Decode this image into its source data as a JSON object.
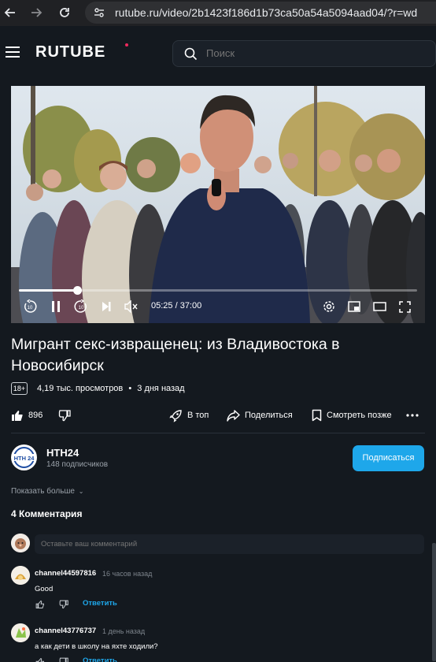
{
  "browser": {
    "url": "rutube.ru/video/2b1423f186d1b73ca50a54a5094aad04/?r=wd"
  },
  "header": {
    "logo": "RUTUBE",
    "search_placeholder": "Поиск"
  },
  "player": {
    "time": "05:25 / 37:00",
    "progress_fraction": 0.1464
  },
  "video": {
    "title": "Мигрант секс-извращенец: из Владивостока в Новосибирск",
    "age_rating": "18+",
    "views": "4,19 тыс. просмотров",
    "posted": "3 дня назад",
    "likes": "896"
  },
  "actions": {
    "top_label": "В топ",
    "share_label": "Поделиться",
    "watch_later_label": "Смотреть позже"
  },
  "channel": {
    "name": "НТН24",
    "avatar_text": "НТН 24",
    "subscribers": "148 подписчиков",
    "subscribe_label": "Подписаться"
  },
  "show_more": "Показать больше",
  "comments": {
    "title": "4 Комментария",
    "input_placeholder": "Оставьте ваш комментарий",
    "reply_label": "Ответить",
    "items": [
      {
        "author": "channel44597816",
        "time": "16 часов назад",
        "text": "Good"
      },
      {
        "author": "channel43776737",
        "time": "1 день назад",
        "text": "а как дети в школу на яхте ходили?"
      }
    ]
  },
  "colors": {
    "accent": "#1ea7ea",
    "logo_dot": "#ef2a5d",
    "background": "#14191f"
  }
}
